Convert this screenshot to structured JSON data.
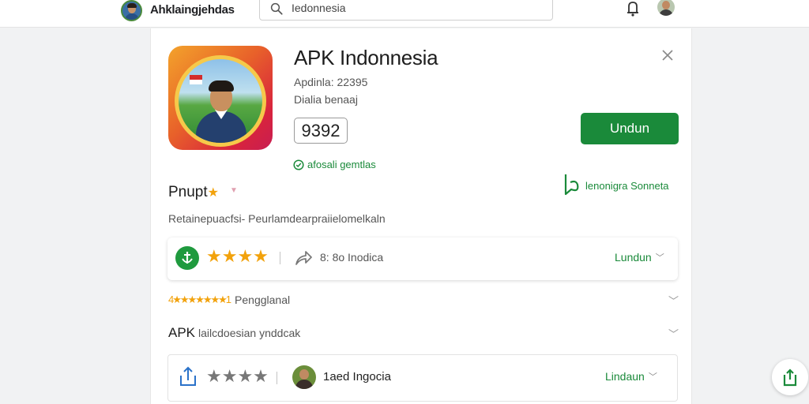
{
  "header": {
    "brand_name": "Ahklaingjehdas",
    "search_value": "Iedonnesia"
  },
  "app": {
    "title": "APK Indonnesia",
    "meta_line_1": "Apdinla:  22395",
    "meta_line_2": "Dialia benaaj",
    "version": "9392",
    "install_label": "Undun",
    "safe_text": "afosali gemtlas",
    "developer_text": "lenonigra Sonneta"
  },
  "section": {
    "title": "Pnupt",
    "subtitle": "Retainepuacfsi-   Peurlamdearpraiielomelkaln"
  },
  "rating_box": {
    "stars": "★★★★",
    "downloads": "8: 8o  Inodica",
    "link_label": "Lundun"
  },
  "rows": [
    {
      "stars": "4★★★★★★★1",
      "label": "Pengglanal"
    },
    {
      "strong": "APK",
      "label": "lailcdoesian ynddcak"
    }
  ],
  "review_box": {
    "stars": "★★★★",
    "reviewer": "1aed Ingocia",
    "link_label": "Lindaun"
  },
  "icons": {
    "search": "search-icon",
    "bell": "bell-icon",
    "close": "close-icon",
    "share": "share-icon",
    "upload": "upload-icon",
    "fab": "share-app-icon"
  },
  "colors": {
    "accent_green": "#1a8a3a",
    "star_orange": "#f2a20c"
  }
}
